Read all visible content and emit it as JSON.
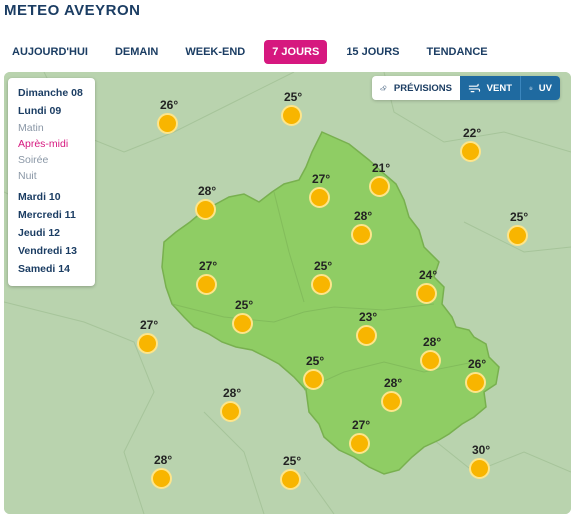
{
  "app": {
    "title": "METEO AVEYRON"
  },
  "tabs": [
    {
      "label": "AUJOURD'HUI",
      "active": false
    },
    {
      "label": "DEMAIN",
      "active": false
    },
    {
      "label": "WEEK-END",
      "active": false
    },
    {
      "label": "7 JOURS",
      "active": true
    },
    {
      "label": "15 JOURS",
      "active": false
    },
    {
      "label": "TENDANCE",
      "active": false
    }
  ],
  "colors": {
    "accent": "#d6187f",
    "brand": "#1b3d63",
    "toggle_active": "#1f6aa0",
    "region_fill": "#8fcd64",
    "sun": "#f8b500"
  },
  "days_panel": {
    "days_top": [
      "Dimanche 08",
      "Lundi 09"
    ],
    "periods": [
      {
        "label": "Matin",
        "active": false
      },
      {
        "label": "Après-midi",
        "active": true
      },
      {
        "label": "Soirée",
        "active": false
      },
      {
        "label": "Nuit",
        "active": false
      }
    ],
    "days_bottom": [
      "Mardi 10",
      "Mercredi 11",
      "Jeudi 12",
      "Vendredi 13",
      "Samedi 14"
    ]
  },
  "view_toggle": {
    "previsions_label": "PRÉVISIONS",
    "vent_label": "VENT",
    "uv_label": "UV",
    "icons": [
      "cloud-sun-icon",
      "wind-icon",
      "sun-uv-icon"
    ]
  },
  "forecasts": [
    {
      "temp": "26°",
      "icon": "sun-icon"
    },
    {
      "temp": "25°",
      "icon": "sun-icon"
    },
    {
      "temp": "22°",
      "icon": "sun-icon"
    },
    {
      "temp": "21°",
      "icon": "sun-icon"
    },
    {
      "temp": "28°",
      "icon": "sun-icon"
    },
    {
      "temp": "27°",
      "icon": "sun-icon"
    },
    {
      "temp": "28°",
      "icon": "sun-icon"
    },
    {
      "temp": "25°",
      "icon": "sun-icon"
    },
    {
      "temp": "27°",
      "icon": "sun-icon"
    },
    {
      "temp": "25°",
      "icon": "sun-icon"
    },
    {
      "temp": "24°",
      "icon": "sun-icon"
    },
    {
      "temp": "25°",
      "icon": "sun-icon"
    },
    {
      "temp": "23°",
      "icon": "sun-icon"
    },
    {
      "temp": "27°",
      "icon": "sun-icon"
    },
    {
      "temp": "28°",
      "icon": "sun-icon"
    },
    {
      "temp": "25°",
      "icon": "sun-icon"
    },
    {
      "temp": "26°",
      "icon": "sun-icon"
    },
    {
      "temp": "28°",
      "icon": "sun-icon"
    },
    {
      "temp": "28°",
      "icon": "sun-icon"
    },
    {
      "temp": "27°",
      "icon": "sun-icon"
    },
    {
      "temp": "30°",
      "icon": "sun-icon"
    },
    {
      "temp": "28°",
      "icon": "sun-icon"
    },
    {
      "temp": "25°",
      "icon": "sun-icon"
    }
  ]
}
